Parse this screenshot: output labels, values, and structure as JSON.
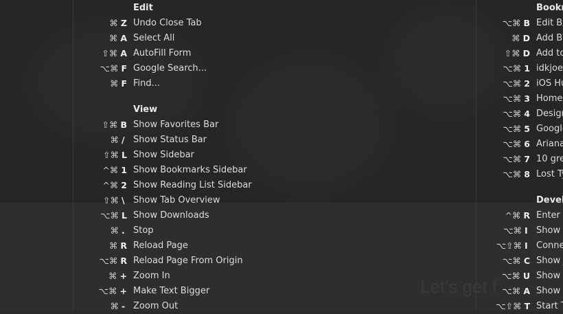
{
  "background": {
    "faint_text": "Let's get f"
  },
  "left_column": {
    "sections": [
      {
        "title": "Edit",
        "items": [
          {
            "mods": "⌘",
            "key": "Z",
            "label": "Undo Close Tab"
          },
          {
            "mods": "⌘",
            "key": "A",
            "label": "Select All"
          },
          {
            "mods": "⇧⌘",
            "key": "A",
            "label": "AutoFill Form"
          },
          {
            "mods": "⌥⌘",
            "key": "F",
            "label": "Google Search..."
          },
          {
            "mods": "⌘",
            "key": "F",
            "label": "Find..."
          }
        ]
      },
      {
        "title": "View",
        "items": [
          {
            "mods": "⇧⌘",
            "key": "B",
            "label": "Show Favorites Bar"
          },
          {
            "mods": "⌘",
            "key": "/",
            "label": "Show Status Bar"
          },
          {
            "mods": "⇧⌘",
            "key": "L",
            "label": "Show Sidebar"
          },
          {
            "mods": "^⌘",
            "key": "1",
            "label": "Show Bookmarks Sidebar"
          },
          {
            "mods": "^⌘",
            "key": "2",
            "label": "Show Reading List Sidebar"
          },
          {
            "mods": "⇧⌘",
            "key": "\\",
            "label": "Show Tab Overview"
          },
          {
            "mods": "⌥⌘",
            "key": "L",
            "label": "Show Downloads"
          },
          {
            "mods": "⌘",
            "key": ".",
            "label": "Stop"
          },
          {
            "mods": "⌘",
            "key": "R",
            "label": "Reload Page"
          },
          {
            "mods": "⌥⌘",
            "key": "R",
            "label": "Reload Page From Origin"
          },
          {
            "mods": "⌘",
            "key": "+",
            "label": "Zoom In"
          },
          {
            "mods": "⌥⌘",
            "key": "+",
            "label": "Make Text Bigger"
          },
          {
            "mods": "⌘",
            "key": "-",
            "label": "Zoom Out"
          }
        ]
      }
    ]
  },
  "right_column": {
    "sections": [
      {
        "title": "Bookn",
        "items": [
          {
            "mods": "⌥⌘",
            "key": "B",
            "label": "Edit Bo"
          },
          {
            "mods": "⌘",
            "key": "D",
            "label": "Add Bo"
          },
          {
            "mods": "⇧⌘",
            "key": "D",
            "label": "Add to"
          },
          {
            "mods": "⌥⌘",
            "key": "1",
            "label": "idkjoel"
          },
          {
            "mods": "⌥⌘",
            "key": "2",
            "label": "iOS Hu"
          },
          {
            "mods": "⌥⌘",
            "key": "3",
            "label": "Homep"
          },
          {
            "mods": "⌥⌘",
            "key": "4",
            "label": "Design"
          },
          {
            "mods": "⌥⌘",
            "key": "5",
            "label": "Google"
          },
          {
            "mods": "⌥⌘",
            "key": "6",
            "label": "Ariana"
          },
          {
            "mods": "⌥⌘",
            "key": "7",
            "label": "10 gre"
          },
          {
            "mods": "⌥⌘",
            "key": "8",
            "label": "Lost Ty"
          }
        ]
      },
      {
        "title": "Develo",
        "items": [
          {
            "mods": "^⌘",
            "key": "R",
            "label": "Enter R"
          },
          {
            "mods": "⌥⌘",
            "key": "I",
            "label": "Show W"
          },
          {
            "mods": "⌥⇧⌘",
            "key": "I",
            "label": "Conne"
          },
          {
            "mods": "⌥⌘",
            "key": "C",
            "label": "Show J"
          },
          {
            "mods": "⌥⌘",
            "key": "U",
            "label": "Show P"
          },
          {
            "mods": "⌥⌘",
            "key": "A",
            "label": "Show E"
          },
          {
            "mods": "⌥⇧⌘",
            "key": "T",
            "label": "Start T"
          }
        ]
      }
    ]
  }
}
